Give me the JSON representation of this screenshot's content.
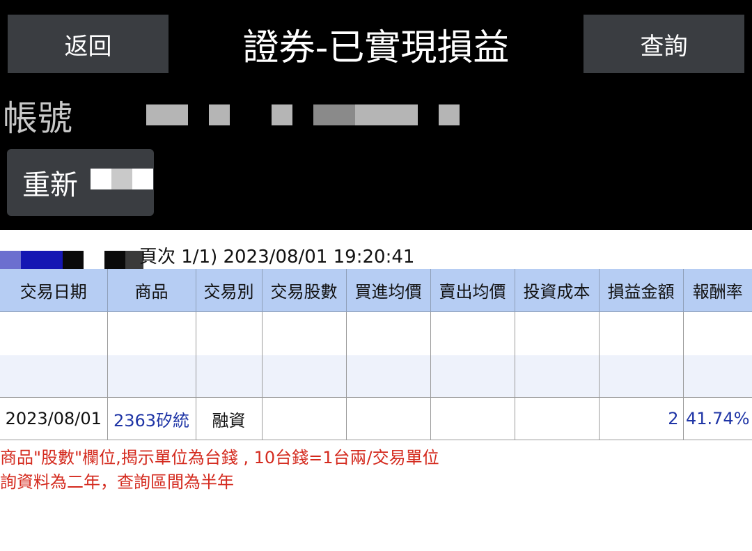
{
  "header": {
    "back_label": "返回",
    "title": "證券-已實現損益",
    "query_label": "查詢"
  },
  "account": {
    "label": "帳號"
  },
  "refresh": {
    "label": "重新"
  },
  "page_info": "頁次 1/1) 2023/08/01 19:20:41",
  "table": {
    "columns": [
      "交易日期",
      "商品",
      "交易別",
      "交易股數",
      "買進均價",
      "賣出均價",
      "投資成本",
      "損益金額",
      "報酬率"
    ],
    "rows": [
      {
        "date": "2023/08/01",
        "product": "2363矽統",
        "type": "融資",
        "shares": "",
        "buy_avg": "",
        "sell_avg": "",
        "cost": "",
        "pl_amount": "2",
        "return_rate": "41.74%"
      }
    ]
  },
  "notes": [
    "商品\"股數\"欄位,揭示單位為台錢 , 10台錢=1台兩/交易單位",
    "詢資料為二年，查詢區間為半年"
  ],
  "colors": {
    "header_bg": "#000000",
    "button_bg": "#3a3d41",
    "table_header_bg": "#b6cdf3",
    "link_blue": "#1f35a6",
    "note_red": "#d42a1e"
  }
}
